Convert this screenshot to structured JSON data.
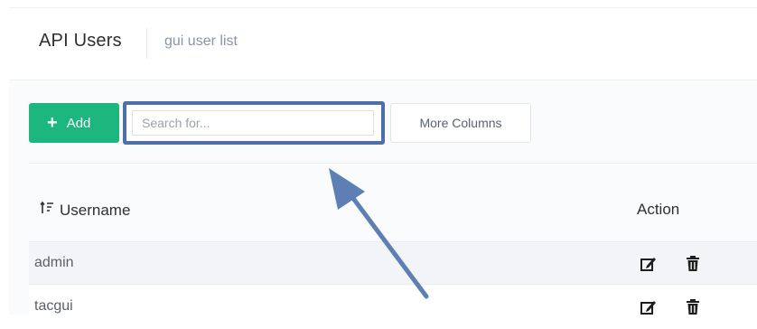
{
  "header": {
    "title": "API Users",
    "breadcrumb": "gui user list"
  },
  "toolbar": {
    "add_label": "Add",
    "search_placeholder": "Search for...",
    "more_columns_label": "More Columns"
  },
  "table": {
    "columns": [
      "Username",
      "Action"
    ],
    "rows": [
      {
        "username": "admin"
      },
      {
        "username": "tacgui"
      }
    ]
  },
  "icons": {
    "add": "plus-icon",
    "sort": "sort-icon",
    "edit": "edit-icon",
    "delete": "trash-icon"
  },
  "colors": {
    "accent": "#1bb77f",
    "highlight": "#4d6fa8",
    "breadcrumb": "#8a94a8"
  }
}
